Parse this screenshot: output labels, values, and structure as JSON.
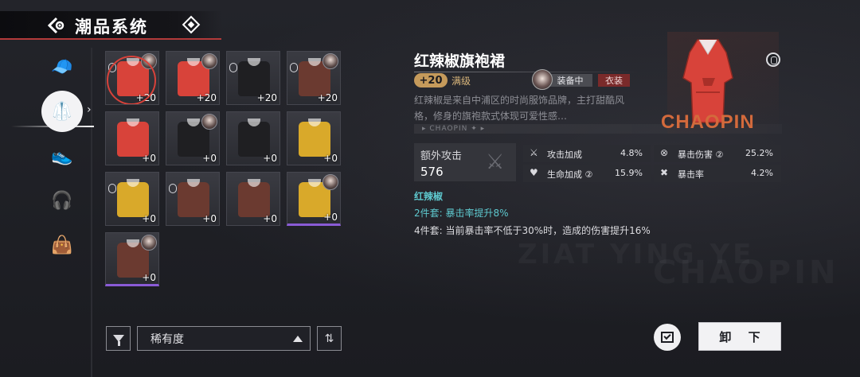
{
  "header": {
    "title": "潮品系统"
  },
  "nav": {
    "items": [
      {
        "name": "hat-icon",
        "glyph": "🧢"
      },
      {
        "name": "jacket-icon",
        "glyph": "🥼"
      },
      {
        "name": "shoe-icon",
        "glyph": "👟"
      },
      {
        "name": "headphones-icon",
        "glyph": "🎧"
      },
      {
        "name": "bag-icon",
        "glyph": "👜"
      }
    ],
    "active_index": 1
  },
  "inventory": [
    {
      "level": "+20",
      "color": "#d8433a",
      "lock": true,
      "avatar": true,
      "selected": true,
      "purple": false
    },
    {
      "level": "+20",
      "color": "#d8433a",
      "lock": false,
      "avatar": true,
      "selected": false,
      "purple": false
    },
    {
      "level": "+20",
      "color": "#1f1f22",
      "lock": true,
      "avatar": false,
      "selected": false,
      "purple": false
    },
    {
      "level": "+20",
      "color": "#6b3a30",
      "lock": true,
      "avatar": true,
      "selected": false,
      "purple": false
    },
    {
      "level": "+0",
      "color": "#d8433a",
      "lock": false,
      "avatar": false,
      "selected": false,
      "purple": false
    },
    {
      "level": "+0",
      "color": "#1f1f22",
      "lock": false,
      "avatar": true,
      "selected": false,
      "purple": false
    },
    {
      "level": "+0",
      "color": "#1f1f22",
      "lock": false,
      "avatar": false,
      "selected": false,
      "purple": false
    },
    {
      "level": "+0",
      "color": "#d9a92a",
      "lock": false,
      "avatar": false,
      "selected": false,
      "purple": false
    },
    {
      "level": "+0",
      "color": "#d9a92a",
      "lock": true,
      "avatar": false,
      "selected": false,
      "purple": false
    },
    {
      "level": "+0",
      "color": "#6b3a30",
      "lock": true,
      "avatar": false,
      "selected": false,
      "purple": false
    },
    {
      "level": "+0",
      "color": "#6b3a30",
      "lock": false,
      "avatar": false,
      "selected": false,
      "purple": false
    },
    {
      "level": "+0",
      "color": "#d9a92a",
      "lock": false,
      "avatar": true,
      "selected": false,
      "purple": true
    },
    {
      "level": "+0",
      "color": "#6b3a30",
      "lock": false,
      "avatar": true,
      "selected": false,
      "purple": true
    }
  ],
  "controls": {
    "sort_value": "稀有度"
  },
  "detail": {
    "name": "红辣椒旗袍裙",
    "level": "+20",
    "level_text": "满级",
    "equipped_tag": "装备中",
    "type_tag": "衣装",
    "description": "红辣椒是来自中浦区的时尚服饰品牌，主打甜酷风格，修身的旗袍款式体现可爱性感…",
    "banner": "CHAOPIN",
    "brand_art": "CHAOPIN",
    "main_stat": {
      "label": "额外攻击",
      "value": "576"
    },
    "sub_stats": [
      {
        "icon": "⚔",
        "label": "攻击加成",
        "value": "4.8%"
      },
      {
        "icon": "⊗",
        "label": "暴击伤害 ②",
        "value": "25.2%"
      },
      {
        "icon": "♥",
        "label": "生命加成 ②",
        "value": "15.9%"
      },
      {
        "icon": "✖",
        "label": "暴击率",
        "value": "4.2%"
      }
    ],
    "set_name": "红辣椒",
    "set_2": "2件套: 暴击率提升8%",
    "set_4": "4件套: 当前暴击率不低于30%时，造成的伤害提升16%"
  },
  "actions": {
    "unequip_label": "卸 下"
  },
  "colors": {
    "accent_red": "#d8423a",
    "set_cyan": "#5ec9cf",
    "gold": "#c59a5b"
  }
}
